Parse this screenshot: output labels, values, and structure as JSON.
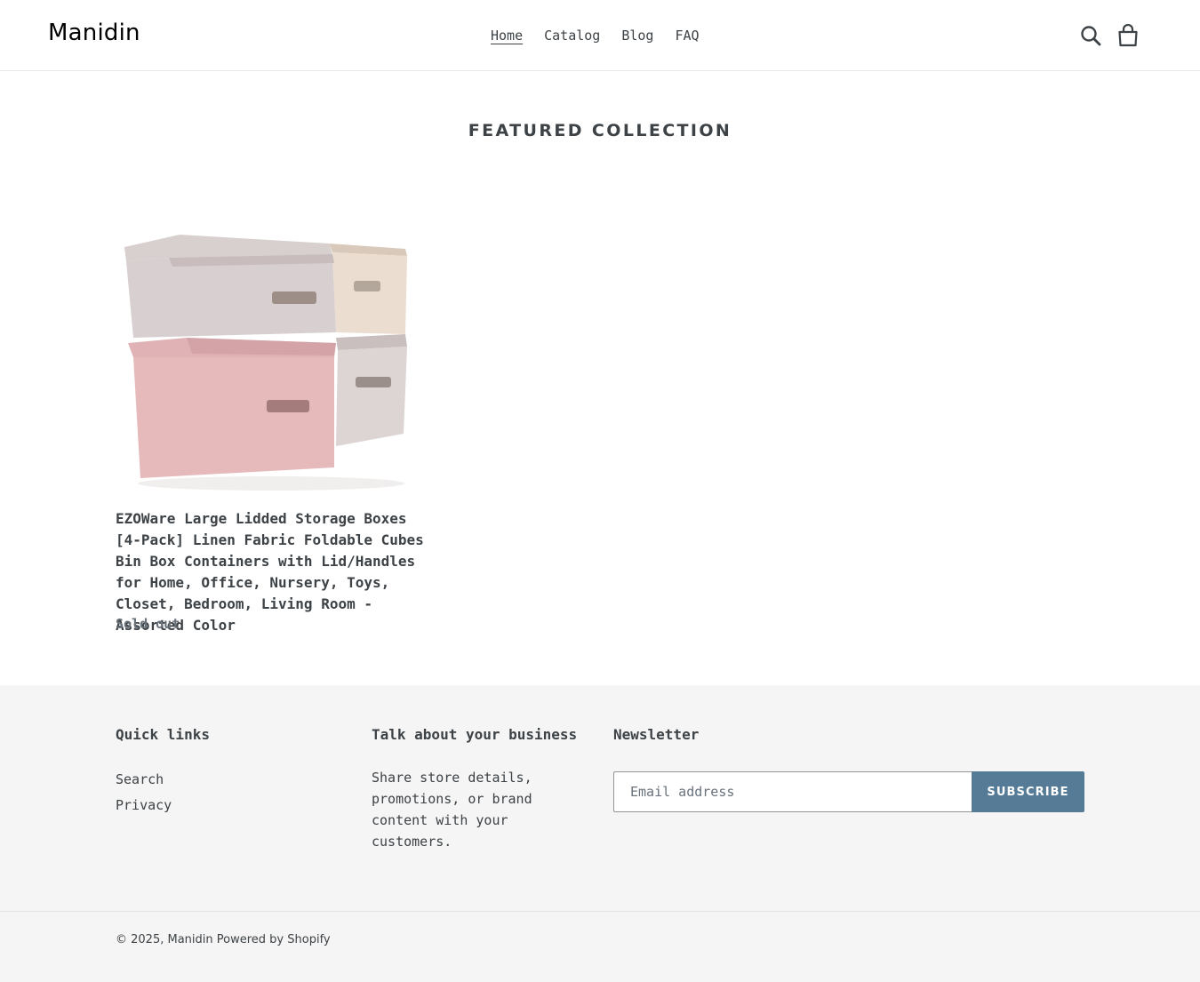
{
  "header": {
    "logo": "Manidin",
    "nav": [
      {
        "label": "Home",
        "active": true
      },
      {
        "label": "Catalog",
        "active": false
      },
      {
        "label": "Blog",
        "active": false
      },
      {
        "label": "FAQ",
        "active": false
      }
    ],
    "icons": [
      "search-icon",
      "cart-icon"
    ]
  },
  "featured": {
    "title": "FEATURED COLLECTION",
    "product": {
      "title": "EZOWare Large Lidded Storage Boxes [4-Pack] Linen Fabric Foldable Cubes Bin Box Containers with Lid/Handles for Home, Office, Nursery, Toys, Closet, Bedroom, Living Room - Assorted Color",
      "status": "Sold out"
    }
  },
  "footer": {
    "quick_links": {
      "heading": "Quick links",
      "links": [
        "Search",
        "Privacy"
      ]
    },
    "business": {
      "heading": "Talk about your business",
      "text": "Share store details, promotions, or brand content with your customers."
    },
    "newsletter": {
      "heading": "Newsletter",
      "placeholder": "Email address",
      "button": "SUBSCRIBE"
    },
    "copyright": {
      "prefix": "© 2025,",
      "shop": "Manidin",
      "powered": "Powered by Shopify"
    }
  },
  "colors": {
    "text": "#3d4246",
    "muted": "#69727b",
    "accent": "#557b97",
    "footer_bg": "#f5f5f5"
  }
}
